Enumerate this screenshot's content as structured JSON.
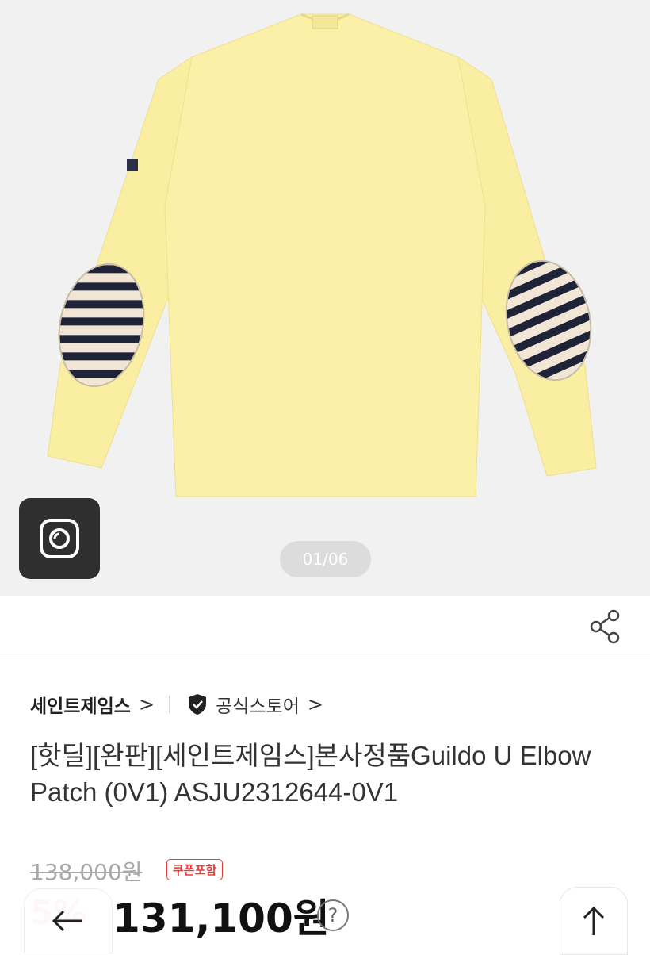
{
  "gallery": {
    "counter": "01/06",
    "shirt_color": "#f9eea1",
    "patch_stripe_color": "#1e2338",
    "patch_base_color": "#f1e6d6"
  },
  "store": {
    "brand": "세인트제임스",
    "brand_chevron": ">",
    "official_label": "공식스토어",
    "official_chevron": ">"
  },
  "product": {
    "title": "[핫딜][완판][세인트제임스]본사정품Guildo U Elbow Patch (0V1) ASJU2312644-0V1"
  },
  "price": {
    "original": "138,000원",
    "coupon_badge": "쿠폰포함",
    "discount": "5%",
    "final": "131,100원",
    "help": "?"
  },
  "colors": {
    "accent_red": "#ea3a3a",
    "counter_bg": "#dcdcdc"
  },
  "icons": {
    "lens": "lens-icon",
    "share": "share-icon",
    "official_badge": "shield-check-icon",
    "back": "arrow-left-icon",
    "top": "arrow-up-icon"
  }
}
